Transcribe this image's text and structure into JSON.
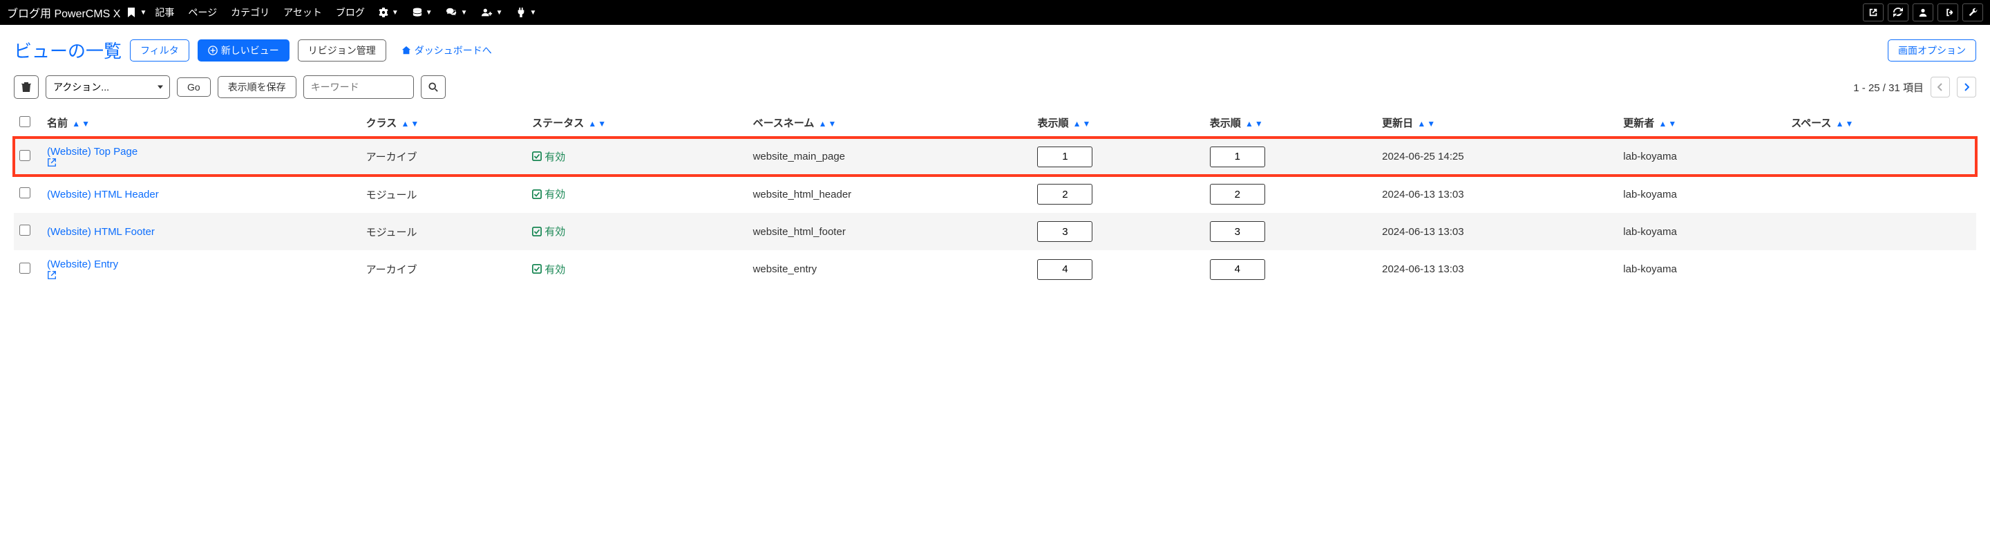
{
  "nav": {
    "brand": "ブログ用 PowerCMS X",
    "items": [
      "記事",
      "ページ",
      "カテゴリ",
      "アセット",
      "ブログ"
    ]
  },
  "header": {
    "title": "ビューの一覧",
    "filter": "フィルタ",
    "new_view": "新しいビュー",
    "revisions": "リビジョン管理",
    "dashboard": "ダッシュボードへ",
    "screen_options": "画面オプション"
  },
  "toolbar": {
    "action_placeholder": "アクション...",
    "go": "Go",
    "save_order": "表示順を保存",
    "keyword_placeholder": "キーワード",
    "pager_text": "1 - 25 / 31 項目"
  },
  "columns": {
    "name": "名前",
    "class": "クラス",
    "status": "ステータス",
    "basename": "ベースネーム",
    "order1": "表示順",
    "order2": "表示順",
    "updated": "更新日",
    "updater": "更新者",
    "space": "スペース"
  },
  "status_label": "有効",
  "rows": [
    {
      "name": "(Website) Top Page",
      "ext": true,
      "class": "アーカイブ",
      "basename": "website_main_page",
      "o1": "1",
      "o2": "1",
      "updated": "2024-06-25 14:25",
      "updater": "lab-koyama",
      "highlight": true
    },
    {
      "name": "(Website) HTML Header",
      "ext": false,
      "class": "モジュール",
      "basename": "website_html_header",
      "o1": "2",
      "o2": "2",
      "updated": "2024-06-13 13:03",
      "updater": "lab-koyama",
      "highlight": false
    },
    {
      "name": "(Website) HTML Footer",
      "ext": false,
      "class": "モジュール",
      "basename": "website_html_footer",
      "o1": "3",
      "o2": "3",
      "updated": "2024-06-13 13:03",
      "updater": "lab-koyama",
      "highlight": false
    },
    {
      "name": "(Website) Entry",
      "ext": true,
      "class": "アーカイブ",
      "basename": "website_entry",
      "o1": "4",
      "o2": "4",
      "updated": "2024-06-13 13:03",
      "updater": "lab-koyama",
      "highlight": false
    }
  ]
}
